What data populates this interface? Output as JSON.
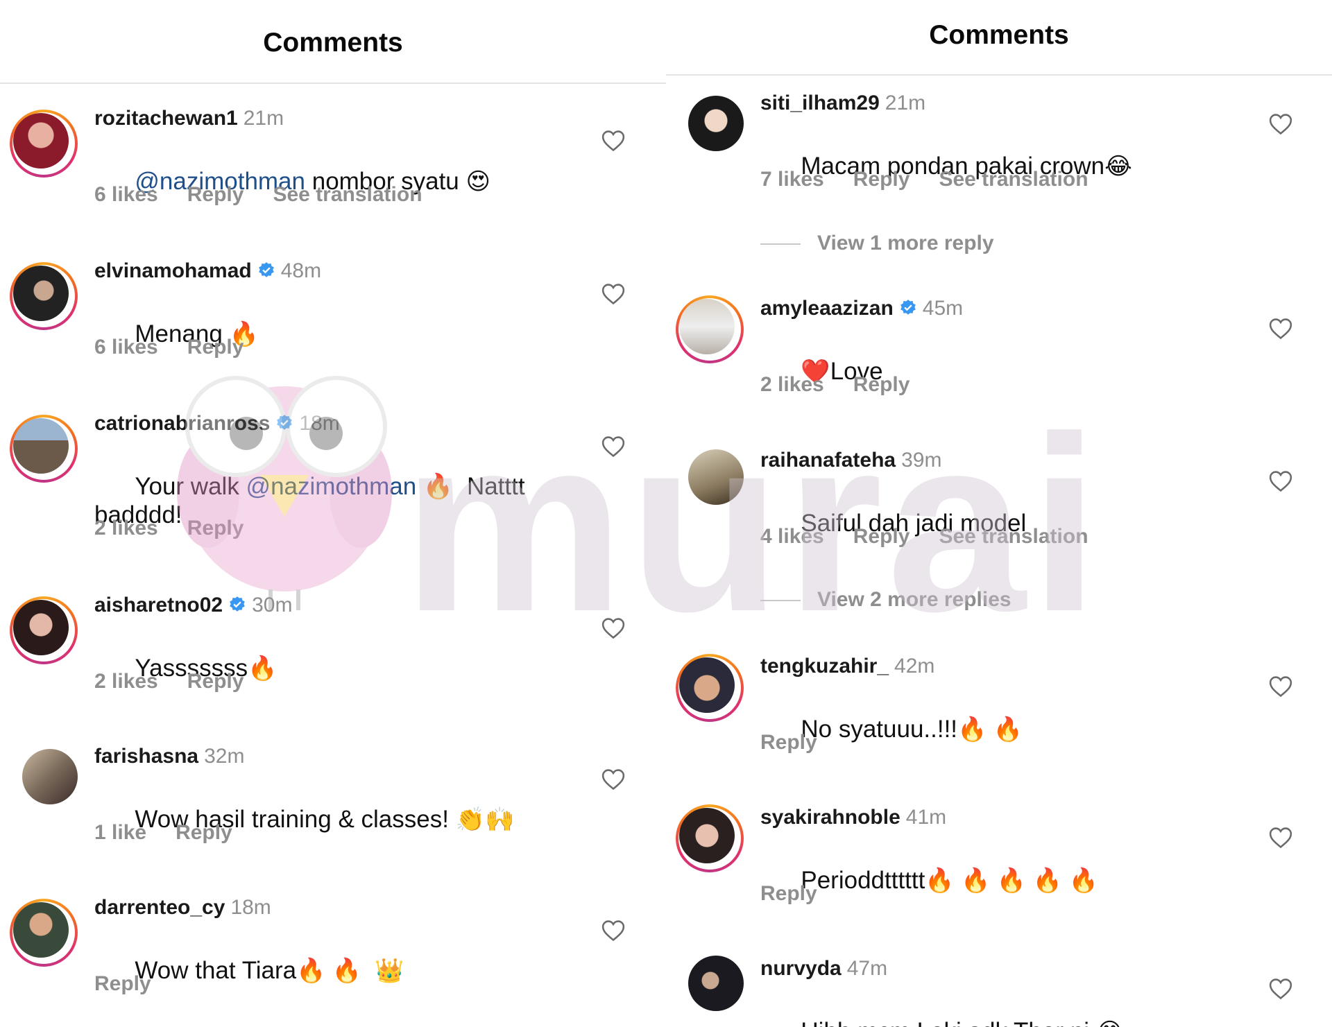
{
  "left": {
    "title": "Comments",
    "comments": [
      {
        "user": "rozitachewan1",
        "verified": false,
        "time": "21m",
        "mention": "@nazimothman",
        "text": " nombor syatu ",
        "emoji": "😍",
        "likes": "6 likes",
        "reply": "Reply",
        "translation": "See translation"
      },
      {
        "user": "elvinamohamad",
        "verified": true,
        "time": "48m",
        "text": "Menang ",
        "emoji": "🔥",
        "likes": "6 likes",
        "reply": "Reply"
      },
      {
        "user": "catrionabrianross",
        "verified": true,
        "time": "18m",
        "pre": "Your walk ",
        "mention": "@nazimothman",
        "post": " 🔥  Natttt",
        "line2": "badddd!",
        "likes": "2 likes",
        "reply": "Reply"
      },
      {
        "user": "aisharetno02",
        "verified": true,
        "time": "30m",
        "text": "Yasssssss",
        "emoji": "🔥",
        "likes": "2 likes",
        "reply": "Reply"
      },
      {
        "user": "farishasna",
        "verified": false,
        "time": "32m",
        "text": "Wow hasil training & classes! ",
        "emoji": "👏🙌",
        "likes": "1 like",
        "reply": "Reply"
      },
      {
        "user": "darrenteo_cy",
        "verified": false,
        "time": "18m",
        "text": "Wow that Tiara",
        "emoji": "🔥 🔥  👑",
        "reply": "Reply"
      }
    ]
  },
  "right": {
    "title": "Comments",
    "comments": [
      {
        "user": "siti_ilham29",
        "verified": false,
        "time": "21m",
        "text": "Macam pondan pakai crown",
        "emoji": "😂",
        "likes": "7 likes",
        "reply": "Reply",
        "translation": "See translation",
        "view_more": "View 1 more reply"
      },
      {
        "user": "amyleaazizan",
        "verified": true,
        "time": "45m",
        "emoji": "❤️",
        "text": "Love",
        "likes": "2 likes",
        "reply": "Reply"
      },
      {
        "user": "raihanafateha",
        "verified": false,
        "time": "39m",
        "text": "Saiful dah jadi model",
        "likes": "4 likes",
        "reply": "Reply",
        "translation": "See translation",
        "view_more": "View 2 more replies"
      },
      {
        "user": "tengkuzahir_",
        "verified": false,
        "time": "42m",
        "text": "No syatuuu..!!!",
        "emoji": "🔥 🔥",
        "reply": "Reply"
      },
      {
        "user": "syakirahnoble",
        "verified": false,
        "time": "41m",
        "text": "Perioddtttttt",
        "emoji": "🔥 🔥 🔥 🔥 🔥",
        "reply": "Reply"
      },
      {
        "user": "nurvyda",
        "verified": false,
        "time": "47m",
        "text": "Uihh mcm Loki adk Thor ni ",
        "emoji": "😂"
      }
    ]
  },
  "watermark": {
    "text": "murai"
  },
  "colors": {
    "mention": "#1e4f8a",
    "muted": "#8e8e8e",
    "verified": "#3897f0",
    "ring_gradient": [
      "#f9a825",
      "#e1306c",
      "#c13584"
    ]
  },
  "icons": {
    "like": "heart-outline-icon",
    "verified": "verified-badge-icon"
  }
}
